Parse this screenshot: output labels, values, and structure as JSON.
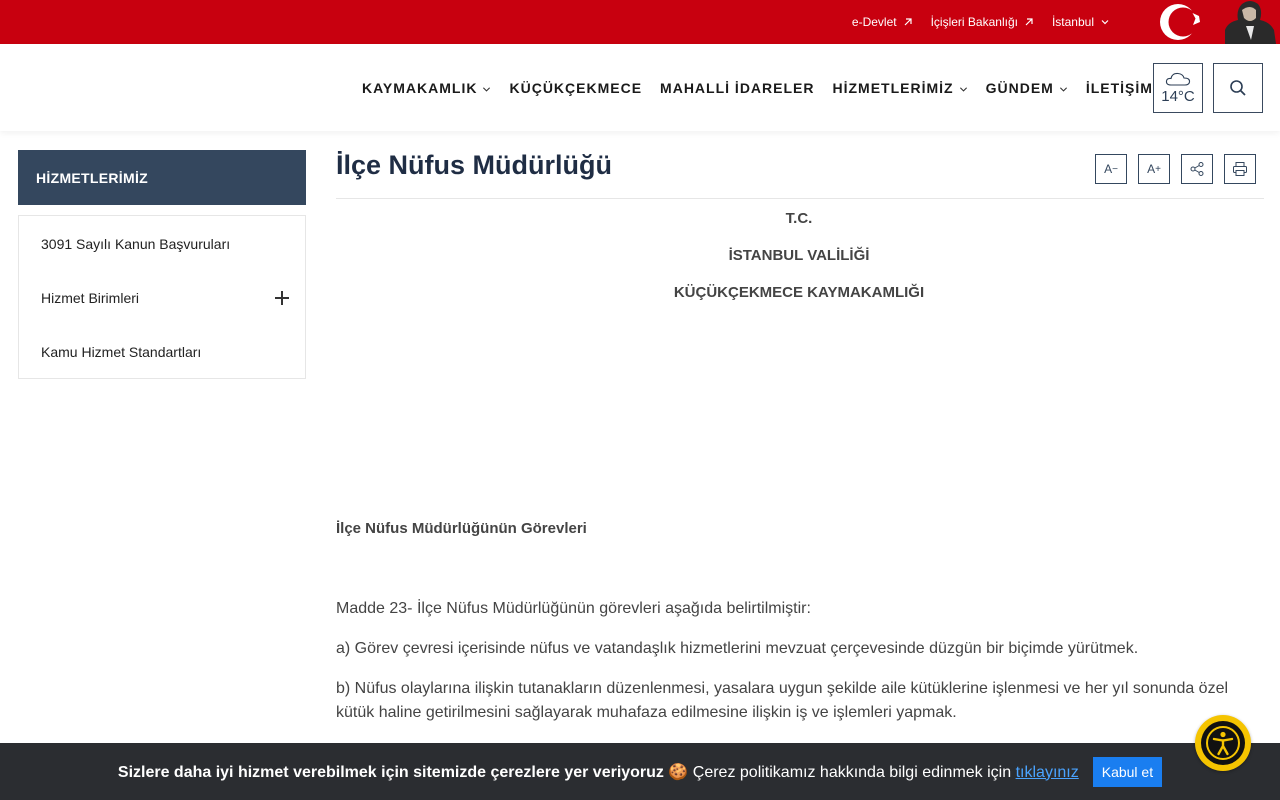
{
  "topbar": {
    "links": [
      {
        "label": "e-Devlet",
        "icon": "external-arrow-icon"
      },
      {
        "label": "İçişleri Bakanlığı",
        "icon": "external-arrow-icon"
      },
      {
        "label": "İstanbul",
        "icon": "chevron-down-icon"
      }
    ],
    "colors": {
      "background": "#c8000f"
    }
  },
  "nav": {
    "items": [
      {
        "label": "KAYMAKAMLIK",
        "dropdown": true
      },
      {
        "label": "KÜÇÜKÇEKMECE",
        "dropdown": false
      },
      {
        "label": "MAHALLİ İDARELER",
        "dropdown": false
      },
      {
        "label": "HİZMETLERİMİZ",
        "dropdown": true
      },
      {
        "label": "GÜNDEM",
        "dropdown": true
      },
      {
        "label": "İLETİŞİM",
        "dropdown": false
      }
    ],
    "weather": {
      "temp": "14°C",
      "icon": "cloud-icon"
    },
    "search_icon": "search-icon"
  },
  "sidebar": {
    "heading": "HİZMETLERİMİZ",
    "items": [
      {
        "label": "3091 Sayılı Kanun Başvuruları",
        "expandable": false
      },
      {
        "label": "Hizmet Birimleri",
        "expandable": true
      },
      {
        "label": "Kamu Hizmet Standartları",
        "expandable": false
      }
    ]
  },
  "content": {
    "title": "İlçe Nüfus Müdürlüğü",
    "tools": {
      "decrease": "A",
      "decrease_sup": "−",
      "increase": "A",
      "increase_sup": "+"
    },
    "header_lines": [
      "T.C.",
      "İSTANBUL VALİLİĞİ",
      "KÜÇÜKÇEKMECE KAYMAKAMLIĞI"
    ],
    "section_title": "İlçe Nüfus Müdürlüğünün Görevleri",
    "paragraphs": [
      "Madde 23- İlçe Nüfus Müdürlüğünün görevleri aşağıda belirtilmiştir:",
      "a) Görev çevresi içerisinde nüfus ve vatandaşlık hizmetlerini mevzuat çerçevesinde düzgün bir biçimde yürütmek.",
      "b) Nüfus olaylarına ilişkin tutanakların düzenlenmesi, yasalara uygun şekilde aile kütüklerine işlenmesi ve her yıl sonunda özel kütük haline getirilmesini sağlayarak muhafaza edilmesine ilişkin iş ve işlemleri yapmak."
    ]
  },
  "cookie": {
    "bold_text": "Sizlere daha iyi hizmet verebilmek için sitemizde çerezlere yer veriyoruz",
    "emoji": "🍪",
    "text": "Çerez politikamız hakkında bilgi edinmek için",
    "link": "tıklayınız",
    "button": "Kabul et"
  },
  "accessibility": {
    "icon": "accessibility-icon",
    "colors": {
      "ring": "#f5c400"
    }
  }
}
